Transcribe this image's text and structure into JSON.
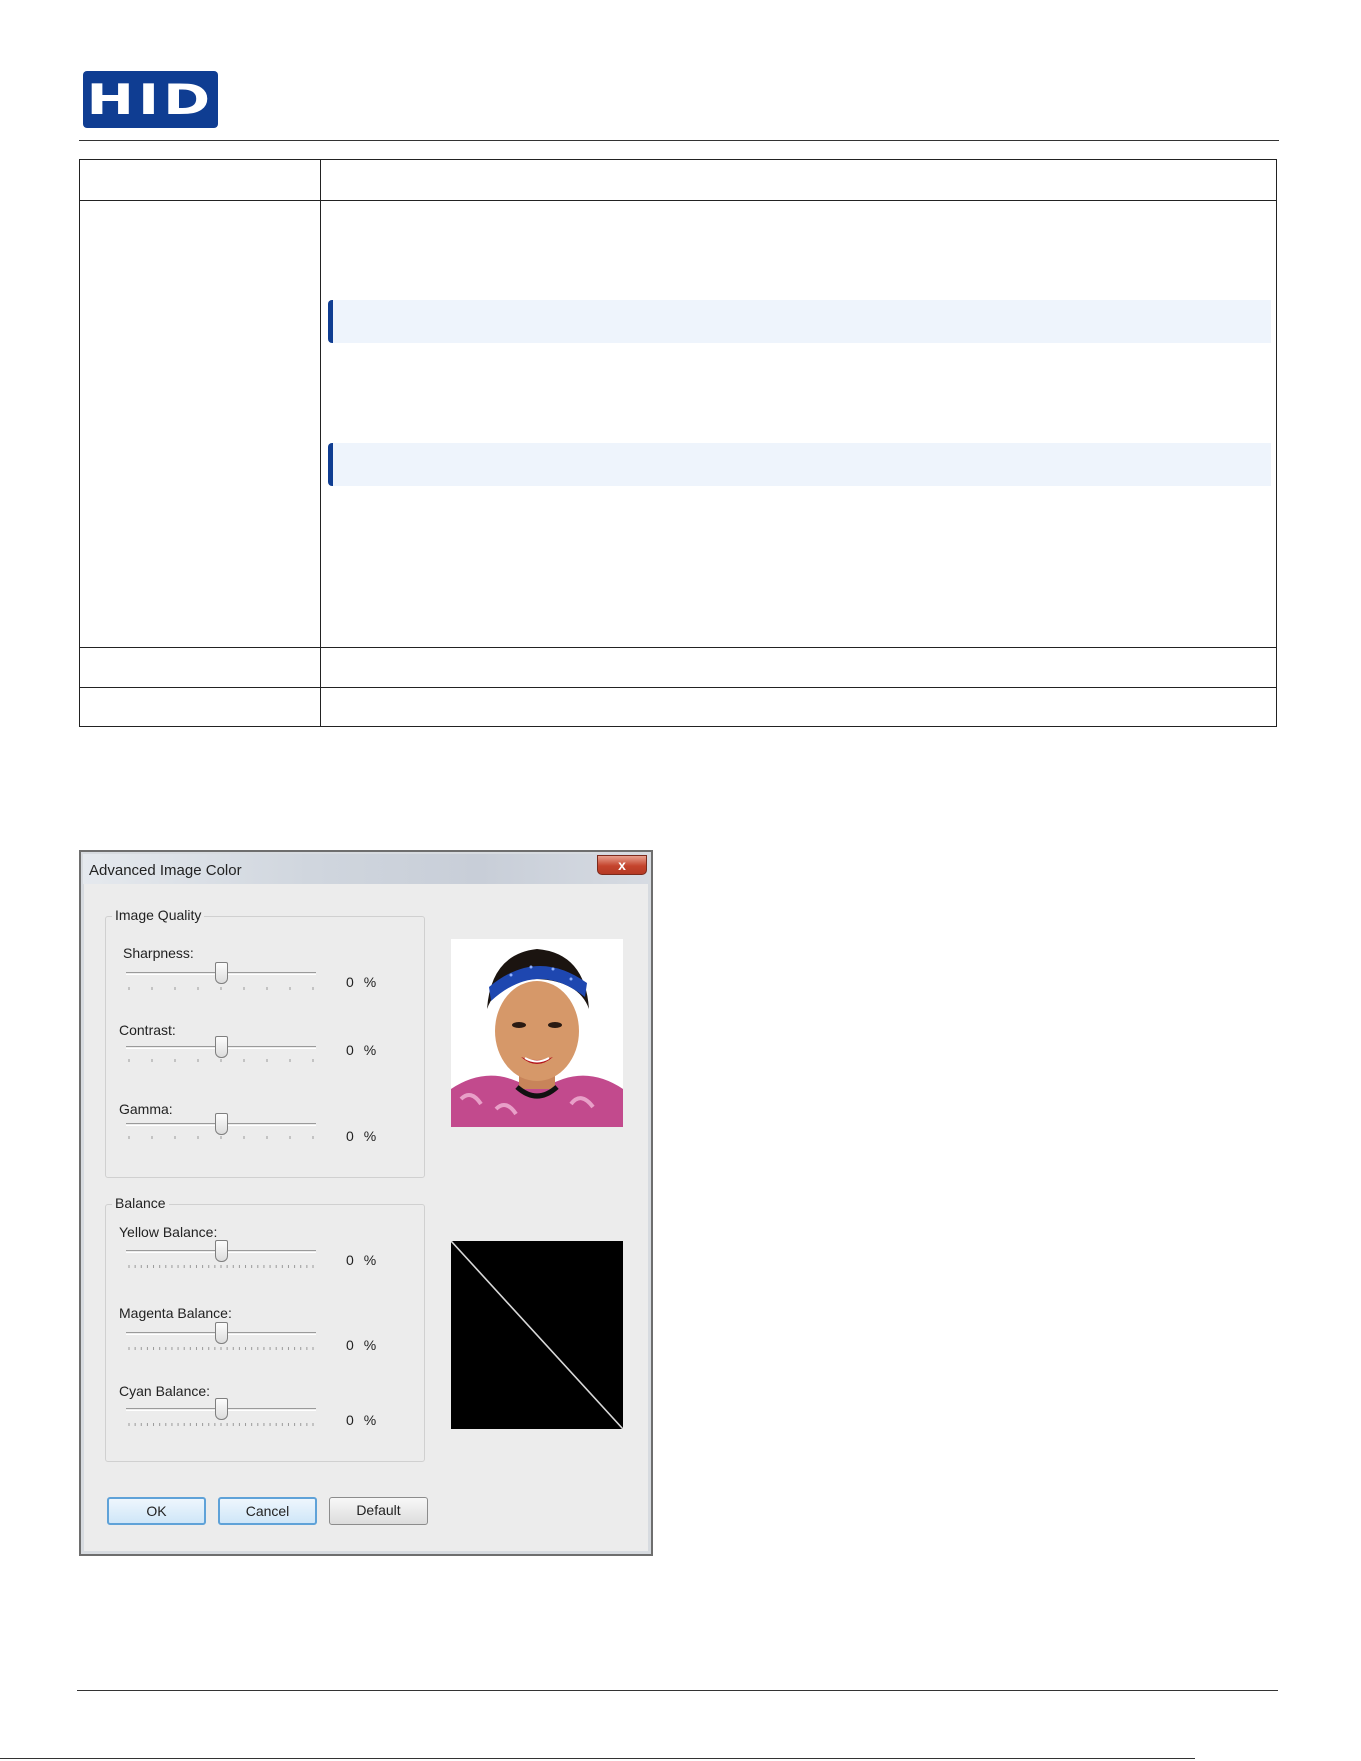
{
  "header": {
    "logo_text": "HID"
  },
  "dialog": {
    "title": "Advanced Image Color",
    "close_symbol": "x",
    "image_quality": {
      "legend": "Image Quality",
      "sliders": [
        {
          "label": "Sharpness:",
          "value": "0",
          "unit": "%"
        },
        {
          "label": "Contrast:",
          "value": "0",
          "unit": "%"
        },
        {
          "label": "Gamma:",
          "value": "0",
          "unit": "%"
        }
      ]
    },
    "balance": {
      "legend": "Balance",
      "sliders": [
        {
          "label": "Yellow Balance:",
          "value": "0",
          "unit": "%"
        },
        {
          "label": "Magenta Balance:",
          "value": "0",
          "unit": "%"
        },
        {
          "label": "Cyan Balance:",
          "value": "0",
          "unit": "%"
        }
      ]
    },
    "buttons": {
      "ok": "OK",
      "cancel": "Cancel",
      "default": "Default"
    }
  },
  "colors": {
    "brand": "#0f3d92",
    "note_bg": "#eef4fc",
    "dialog_bg": "#ececec",
    "button_focus": "#5fa2d8"
  },
  "icons": {
    "close": "close-icon",
    "slider_thumb": "slider-thumb-icon"
  }
}
